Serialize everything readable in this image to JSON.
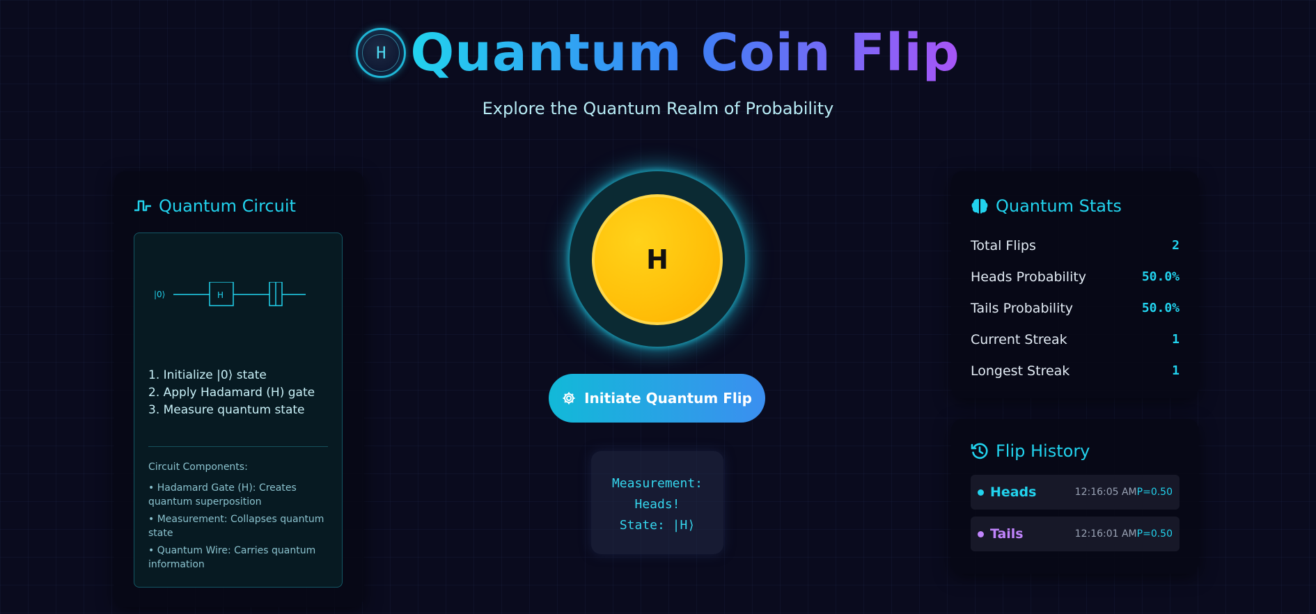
{
  "header": {
    "logo_text": "H",
    "title": "Quantum Coin Flip",
    "subtitle": "Explore the Quantum Realm of Probability"
  },
  "circuit_panel": {
    "title": "Quantum Circuit",
    "icon": "pulse-wave-icon",
    "diagram": {
      "input_label": "|0⟩",
      "gate_label": "H"
    },
    "steps": [
      "1. Initialize |0⟩ state",
      "2. Apply Hadamard (H) gate",
      "3. Measure quantum state"
    ],
    "components_title": "Circuit Components:",
    "components": [
      "• Hadamard Gate (H): Creates quantum superposition",
      "• Measurement: Collapses quantum state",
      "• Quantum Wire: Carries quantum information"
    ]
  },
  "coin": {
    "face": "H",
    "glow_color": "#22d3ee",
    "coin_color": "#ffc10a"
  },
  "flip_button": {
    "icon": "gear-icon",
    "label": "Initiate Quantum Flip"
  },
  "measurement": {
    "line1": "Measurement:",
    "line2": "Heads!",
    "line3": "State: |H⟩"
  },
  "stats_panel": {
    "title": "Quantum Stats",
    "icon": "brain-icon",
    "rows": [
      {
        "label": "Total Flips",
        "value": "2"
      },
      {
        "label": "Heads Probability",
        "value": "50.0%"
      },
      {
        "label": "Tails Probability",
        "value": "50.0%"
      },
      {
        "label": "Current Streak",
        "value": "1"
      },
      {
        "label": "Longest Streak",
        "value": "1"
      }
    ]
  },
  "history_panel": {
    "title": "Flip History",
    "icon": "history-icon",
    "items": [
      {
        "result": "Heads",
        "time": "12:16:05 AM",
        "prob": "P=0.50",
        "color": "#22d3ee"
      },
      {
        "result": "Tails",
        "time": "12:16:01 AM",
        "prob": "P=0.50",
        "color": "#c084fc"
      }
    ]
  },
  "colors": {
    "accent": "#22d3ee",
    "background": "#0a0b1e",
    "tails": "#c084fc"
  }
}
